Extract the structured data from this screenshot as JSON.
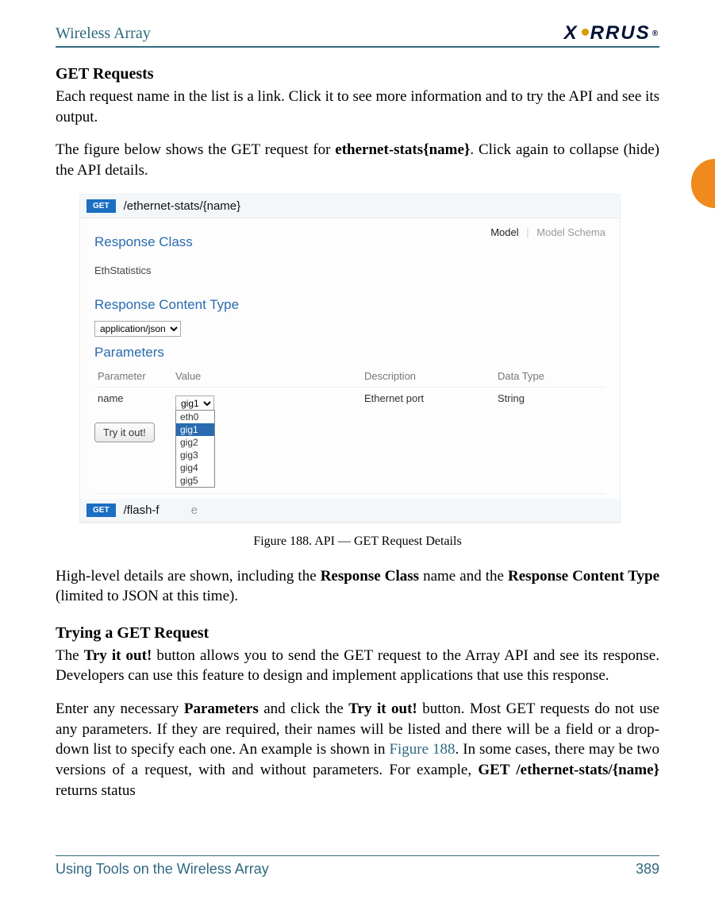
{
  "header": {
    "title": "Wireless Array",
    "logo_text": "X RRUS",
    "logo_tm": "®"
  },
  "section1": {
    "heading": "GET Requests",
    "p1": "Each request name in the list is a link. Click it to see more information and to try the API and see its output.",
    "p2a": "The figure below shows the GET request for ",
    "p2b_bold": "ethernet-stats{name}",
    "p2c": ". Click again to collapse (hide) the API details."
  },
  "figure": {
    "badge": "GET",
    "path": "/ethernet-stats/{name}",
    "resp_class_h": "Response Class",
    "tabs": {
      "model": "Model",
      "schema": "Model Schema"
    },
    "resp_class_val": "EthStatistics",
    "resp_ct_h": "Response Content Type",
    "resp_ct_val": "application/json",
    "params_h": "Parameters",
    "table": {
      "headers": [
        "Parameter",
        "Value",
        "Description",
        "Data Type"
      ],
      "row": {
        "param": "name",
        "value": "gig1",
        "desc": "Ethernet port",
        "type": "String"
      }
    },
    "dropdown_options": [
      "eth0",
      "gig1",
      "gig2",
      "gig3",
      "gig4",
      "gig5"
    ],
    "tryit": "Try it out!",
    "second_badge": "GET",
    "second_path_prefix": "/flash-f",
    "second_path_suffix": "e"
  },
  "figcap": "Figure 188. API — GET Request Details",
  "after_figure": {
    "p_a": "High-level details are shown, including the ",
    "p_b_bold": "Response Class",
    "p_c": " name and the ",
    "p_d_bold": "Response Content Type",
    "p_e": " (limited to JSON at this time)."
  },
  "section2": {
    "heading": "Trying a GET Request",
    "p1_a": "The ",
    "p1_b_bold": "Try it out!",
    "p1_c": " button allows you to send the GET request to the Array API and see its response. Developers can use this feature to design and implement applications that use this response.",
    "p2_a": "Enter any necessary ",
    "p2_b_bold": "Parameters",
    "p2_c": " and click the ",
    "p2_d_bold": "Try it out!",
    "p2_e": " button. Most GET requests do not use any parameters. If they are required, their names will be listed and there will be a field or a drop-down list to specify each one. An example is shown in ",
    "p2_f_link": "Figure 188",
    "p2_g": ". In some cases, there may be two versions of a request, with and without parameters. For example, ",
    "p2_h_bold": "GET /ethernet-stats/{name}",
    "p2_i": " returns status"
  },
  "footer": {
    "left": "Using Tools on the Wireless Array",
    "right": "389"
  }
}
